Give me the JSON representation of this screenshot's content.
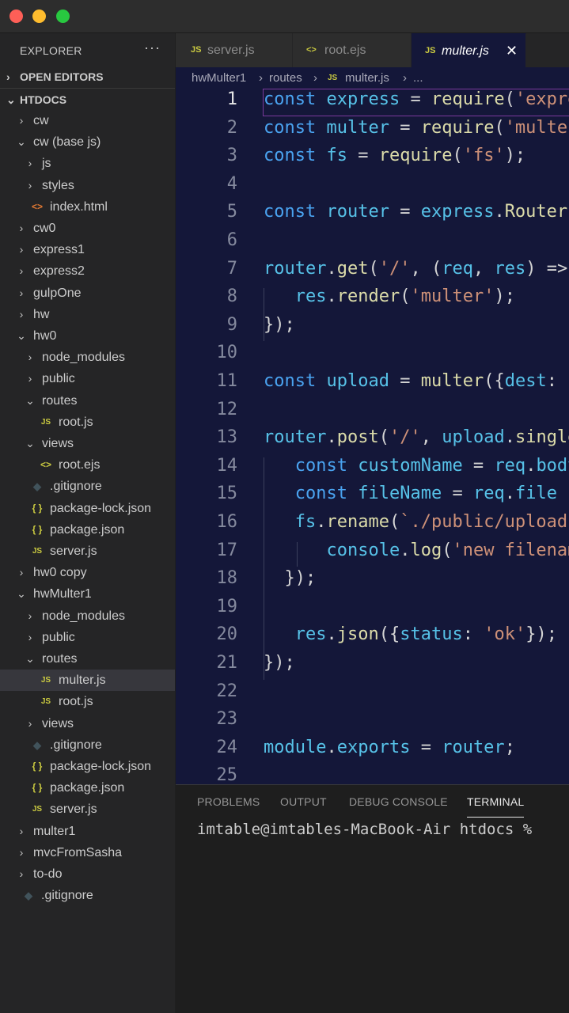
{
  "explorer": {
    "header": "EXPLORER",
    "more": "···",
    "open_editors": "OPEN EDITORS",
    "root": "HTDOCS",
    "items": [
      {
        "label": "cw",
        "type": "folder",
        "open": false,
        "depth": 0
      },
      {
        "label": "cw (base js)",
        "type": "folder",
        "open": true,
        "depth": 0
      },
      {
        "label": "js",
        "type": "folder",
        "open": false,
        "depth": 1
      },
      {
        "label": "styles",
        "type": "folder",
        "open": false,
        "depth": 1
      },
      {
        "label": "index.html",
        "type": "html",
        "depth": 1
      },
      {
        "label": "cw0",
        "type": "folder",
        "open": false,
        "depth": 0
      },
      {
        "label": "express1",
        "type": "folder",
        "open": false,
        "depth": 0
      },
      {
        "label": "express2",
        "type": "folder",
        "open": false,
        "depth": 0
      },
      {
        "label": "gulpOne",
        "type": "folder",
        "open": false,
        "depth": 0
      },
      {
        "label": "hw",
        "type": "folder",
        "open": false,
        "depth": 0
      },
      {
        "label": "hw0",
        "type": "folder",
        "open": true,
        "depth": 0
      },
      {
        "label": "node_modules",
        "type": "folder",
        "open": false,
        "depth": 1
      },
      {
        "label": "public",
        "type": "folder",
        "open": false,
        "depth": 1
      },
      {
        "label": "routes",
        "type": "folder",
        "open": true,
        "depth": 1
      },
      {
        "label": "root.js",
        "type": "js",
        "depth": 2
      },
      {
        "label": "views",
        "type": "folder",
        "open": true,
        "depth": 1
      },
      {
        "label": "root.ejs",
        "type": "ejs",
        "depth": 2
      },
      {
        "label": ".gitignore",
        "type": "git",
        "depth": 1
      },
      {
        "label": "package-lock.json",
        "type": "json",
        "depth": 1
      },
      {
        "label": "package.json",
        "type": "json",
        "depth": 1
      },
      {
        "label": "server.js",
        "type": "js",
        "depth": 1
      },
      {
        "label": "hw0 copy",
        "type": "folder",
        "open": false,
        "depth": 0
      },
      {
        "label": "hwMulter1",
        "type": "folder",
        "open": true,
        "depth": 0
      },
      {
        "label": "node_modules",
        "type": "folder",
        "open": false,
        "depth": 1
      },
      {
        "label": "public",
        "type": "folder",
        "open": false,
        "depth": 1
      },
      {
        "label": "routes",
        "type": "folder",
        "open": true,
        "depth": 1
      },
      {
        "label": "multer.js",
        "type": "js",
        "depth": 2,
        "selected": true
      },
      {
        "label": "root.js",
        "type": "js",
        "depth": 2
      },
      {
        "label": "views",
        "type": "folder",
        "open": false,
        "depth": 1
      },
      {
        "label": ".gitignore",
        "type": "git",
        "depth": 1
      },
      {
        "label": "package-lock.json",
        "type": "json",
        "depth": 1
      },
      {
        "label": "package.json",
        "type": "json",
        "depth": 1
      },
      {
        "label": "server.js",
        "type": "js",
        "depth": 1
      },
      {
        "label": "multer1",
        "type": "folder",
        "open": false,
        "depth": 0
      },
      {
        "label": "mvcFromSasha",
        "type": "folder",
        "open": false,
        "depth": 0
      },
      {
        "label": "to-do",
        "type": "folder",
        "open": false,
        "depth": 0
      },
      {
        "label": ".gitignore",
        "type": "git",
        "depth": 0
      }
    ]
  },
  "tabs": [
    {
      "label": "server.js",
      "icon": "JS"
    },
    {
      "label": "root.ejs",
      "icon": "<>"
    },
    {
      "label": "multer.js",
      "icon": "JS",
      "active": true
    }
  ],
  "tab_close": "✕",
  "breadcrumb": {
    "folder": "hwMulter1",
    "sub": "routes",
    "file_icon": "JS",
    "file": "multer.js",
    "tail": "..."
  },
  "editor": {
    "lines": [
      [
        [
          "k",
          "const "
        ],
        [
          "v",
          "express"
        ],
        [
          "p",
          " = "
        ],
        [
          "f",
          "require"
        ],
        [
          "p",
          "("
        ],
        [
          "s",
          "'express'"
        ],
        [
          "p",
          ");"
        ]
      ],
      [
        [
          "k",
          "const "
        ],
        [
          "v",
          "multer"
        ],
        [
          "p",
          " = "
        ],
        [
          "f",
          "require"
        ],
        [
          "p",
          "("
        ],
        [
          "s",
          "'multer'"
        ],
        [
          "p",
          ");"
        ]
      ],
      [
        [
          "k",
          "const "
        ],
        [
          "v",
          "fs"
        ],
        [
          "p",
          " = "
        ],
        [
          "f",
          "require"
        ],
        [
          "p",
          "("
        ],
        [
          "s",
          "'fs'"
        ],
        [
          "p",
          ");"
        ]
      ],
      [],
      [
        [
          "k",
          "const "
        ],
        [
          "v",
          "router"
        ],
        [
          "p",
          " = "
        ],
        [
          "v",
          "express"
        ],
        [
          "p",
          "."
        ],
        [
          "f",
          "Router"
        ],
        [
          "p",
          "();"
        ]
      ],
      [],
      [
        [
          "v",
          "router"
        ],
        [
          "p",
          "."
        ],
        [
          "f",
          "get"
        ],
        [
          "p",
          "("
        ],
        [
          "s",
          "'/'"
        ],
        [
          "p",
          ", ("
        ],
        [
          "v",
          "req"
        ],
        [
          "p",
          ", "
        ],
        [
          "v",
          "res"
        ],
        [
          "p",
          ") => {"
        ]
      ],
      [
        [
          "p",
          "   "
        ],
        [
          "v",
          "res"
        ],
        [
          "p",
          "."
        ],
        [
          "f",
          "render"
        ],
        [
          "p",
          "("
        ],
        [
          "s",
          "'multer'"
        ],
        [
          "p",
          ");"
        ]
      ],
      [
        [
          "p",
          "});"
        ]
      ],
      [],
      [
        [
          "k",
          "const "
        ],
        [
          "v",
          "upload"
        ],
        [
          "p",
          " = "
        ],
        [
          "f",
          "multer"
        ],
        [
          "p",
          "({"
        ],
        [
          "v",
          "dest"
        ],
        [
          "p",
          ":"
        ]
      ],
      [],
      [
        [
          "v",
          "router"
        ],
        [
          "p",
          "."
        ],
        [
          "f",
          "post"
        ],
        [
          "p",
          "("
        ],
        [
          "s",
          "'/'"
        ],
        [
          "p",
          ", "
        ],
        [
          "v",
          "upload"
        ],
        [
          "p",
          "."
        ],
        [
          "f",
          "single"
        ]
      ],
      [
        [
          "p",
          "   "
        ],
        [
          "k",
          "const "
        ],
        [
          "v",
          "customName"
        ],
        [
          "p",
          " = "
        ],
        [
          "v",
          "req"
        ],
        [
          "p",
          "."
        ],
        [
          "v",
          "body"
        ]
      ],
      [
        [
          "p",
          "   "
        ],
        [
          "k",
          "const "
        ],
        [
          "v",
          "fileName"
        ],
        [
          "p",
          " = "
        ],
        [
          "v",
          "req"
        ],
        [
          "p",
          "."
        ],
        [
          "v",
          "file"
        ]
      ],
      [
        [
          "p",
          "   "
        ],
        [
          "v",
          "fs"
        ],
        [
          "p",
          "."
        ],
        [
          "f",
          "rename"
        ],
        [
          "p",
          "("
        ],
        [
          "s",
          "`./public/uploads"
        ]
      ],
      [
        [
          "p",
          "      "
        ],
        [
          "v",
          "console"
        ],
        [
          "p",
          "."
        ],
        [
          "f",
          "log"
        ],
        [
          "p",
          "("
        ],
        [
          "s",
          "'new filename"
        ]
      ],
      [
        [
          "p",
          "  });"
        ]
      ],
      [],
      [
        [
          "p",
          "   "
        ],
        [
          "v",
          "res"
        ],
        [
          "p",
          "."
        ],
        [
          "f",
          "json"
        ],
        [
          "p",
          "({"
        ],
        [
          "v",
          "status"
        ],
        [
          "p",
          ": "
        ],
        [
          "s",
          "'ok'"
        ],
        [
          "p",
          "});"
        ]
      ],
      [
        [
          "p",
          "});"
        ]
      ],
      [],
      [],
      [
        [
          "v",
          "module"
        ],
        [
          "p",
          "."
        ],
        [
          "v",
          "exports"
        ],
        [
          "p",
          " = "
        ],
        [
          "v",
          "router"
        ],
        [
          "p",
          ";"
        ]
      ],
      []
    ]
  },
  "panel": {
    "tabs": [
      "PROBLEMS",
      "OUTPUT",
      "DEBUG CONSOLE",
      "TERMINAL"
    ],
    "active": 3,
    "terminal_prompt": "imtable@imtables-MacBook-Air htdocs %"
  }
}
